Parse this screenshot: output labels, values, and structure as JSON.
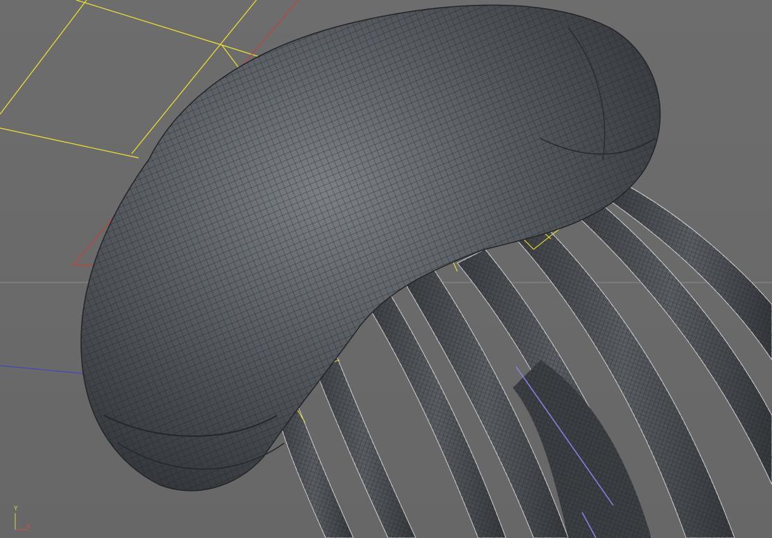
{
  "viewport": {
    "background": "#6a6a6a",
    "mesh_color": "#4c4f53",
    "wire_color": "#1f2124",
    "selection_color": "#f2e52b",
    "camera_color": "#d03a33",
    "axis_blue": "#3b3fd1"
  },
  "axis_gizmo": {
    "y_label": "Y",
    "x_label": "X"
  }
}
